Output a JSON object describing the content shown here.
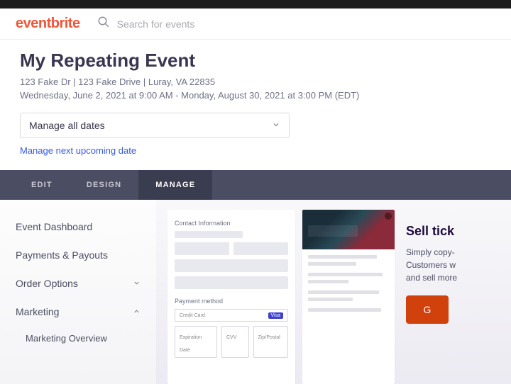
{
  "brand": "eventbrite",
  "search": {
    "placeholder": "Search for events"
  },
  "event": {
    "title": "My Repeating Event",
    "location": "123 Fake Dr | 123 Fake Drive | Luray, VA 22835",
    "daterange": "Wednesday, June 2, 2021 at 9:00 AM - Monday, August 30, 2021 at 3:00 PM (EDT)",
    "dropdown_label": "Manage all dates",
    "next_link": "Manage next upcoming date"
  },
  "tabs": {
    "edit": "EDIT",
    "design": "DESIGN",
    "manage": "MANAGE"
  },
  "sidebar": {
    "dashboard": "Event Dashboard",
    "payments": "Payments & Payouts",
    "orders": "Order Options",
    "marketing": "Marketing",
    "marketing_overview": "Marketing Overview"
  },
  "mock": {
    "contact_label": "Contact Information",
    "payment_label": "Payment method",
    "credit_card": "Credit Card",
    "tag": "Visa",
    "exp": "Expiration Date",
    "cvv": "CVV",
    "zip": "Zip/Postal"
  },
  "promo": {
    "title": "Sell tick",
    "line1": "Simply copy-",
    "line2": "Customers w",
    "line3": "and sell more",
    "cta": "G"
  }
}
